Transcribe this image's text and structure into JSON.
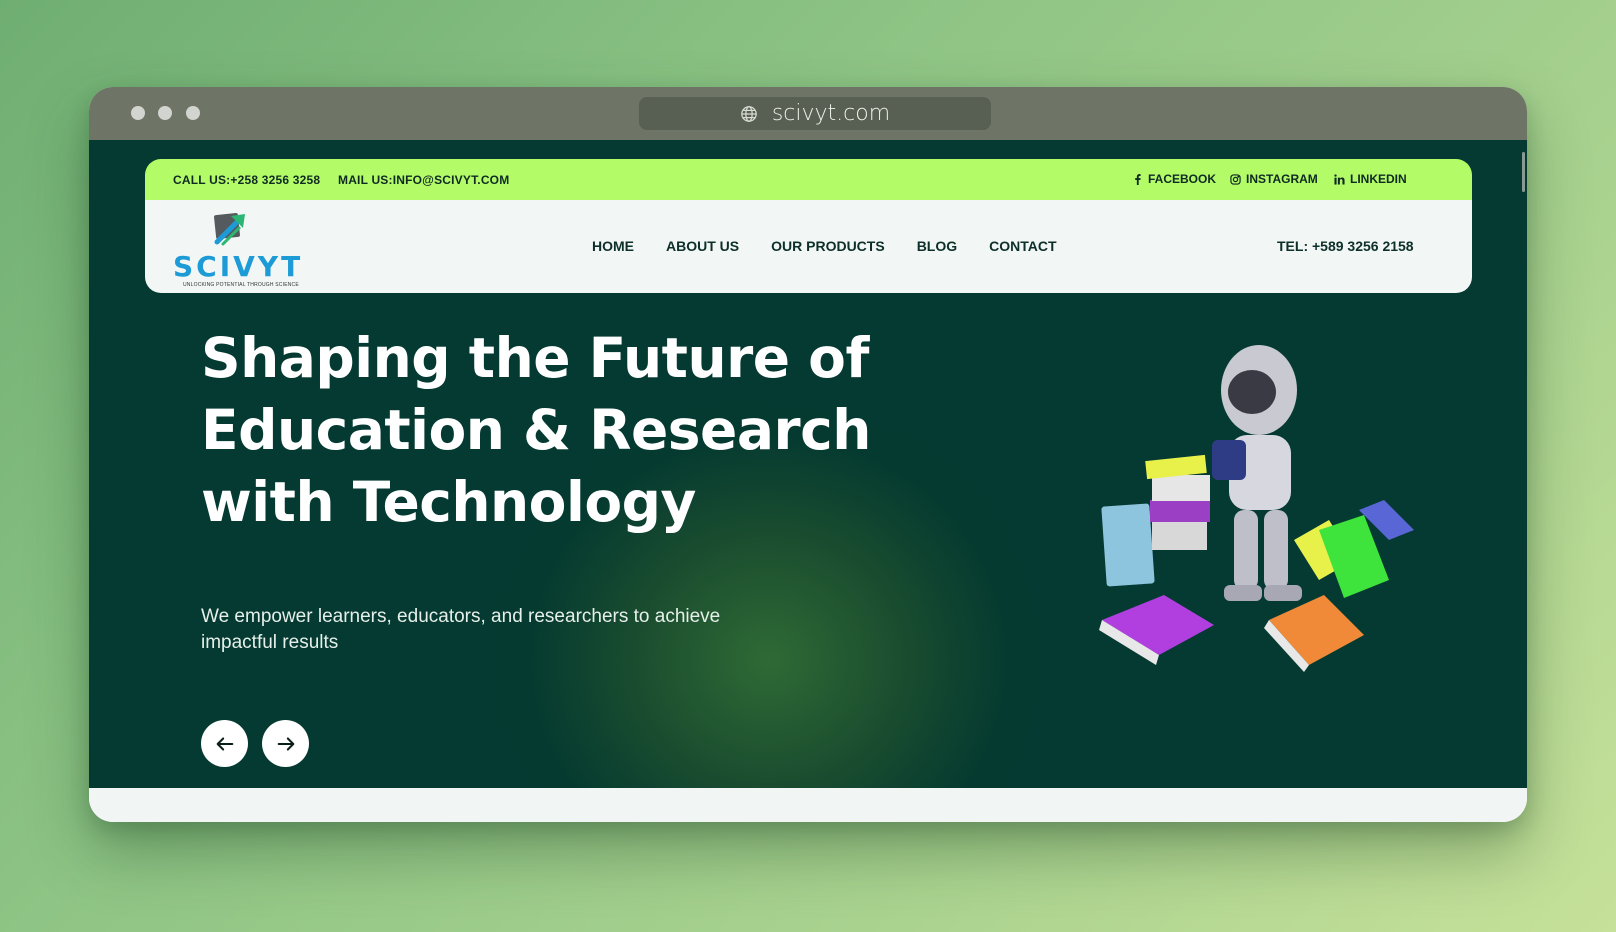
{
  "browser": {
    "url": "scivyt.com"
  },
  "topbar": {
    "call": "CALL US:+258 3256 3258",
    "mail": "MAIL US:INFO@SCIVYT.COM",
    "social": [
      {
        "label": "FACEBOOK",
        "icon": "facebook-icon"
      },
      {
        "label": "INSTAGRAM",
        "icon": "instagram-icon"
      },
      {
        "label": "LINKEDIN",
        "icon": "linkedin-icon"
      }
    ]
  },
  "logo": {
    "brand": "SCIVYT",
    "tagline": "UNLOCKING POTENTIAL THROUGH SCIENCE"
  },
  "nav": {
    "items": [
      "HOME",
      "ABOUT US",
      "OUR PRODUCTS",
      "BLOG",
      "CONTACT"
    ],
    "tel": "TEL: +589 3256 2158"
  },
  "hero": {
    "title": "Shaping the Future of Education & Research with Technology",
    "subtitle": "We empower learners, educators, and researchers to achieve impactful results",
    "prev_icon": "arrow-left-icon",
    "next_icon": "arrow-right-icon",
    "image_icon": "robot-reading-books-illustration"
  },
  "colors": {
    "hero_bg": "#043a32",
    "accent_green": "#b4fb68",
    "brand_blue": "#1c9bd7",
    "nav_text": "#0d2f29"
  }
}
